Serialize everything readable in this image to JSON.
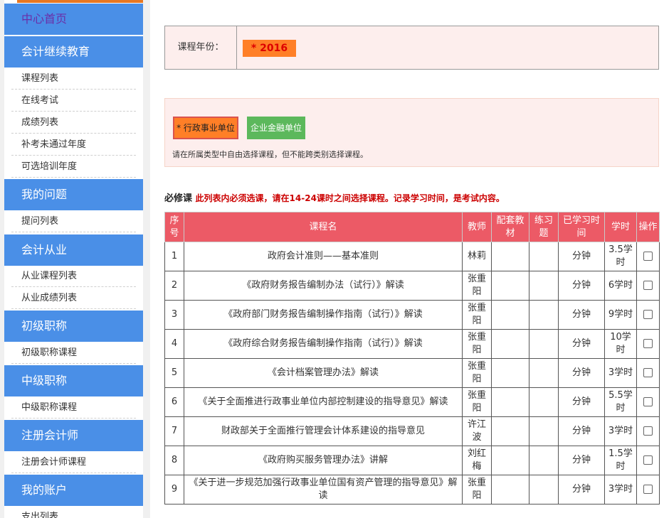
{
  "sidebar": {
    "sections": [
      {
        "title": "中心首页",
        "items": []
      },
      {
        "title": "会计继续教育",
        "items": [
          "课程列表",
          "在线考试",
          "成绩列表",
          "补考未通过年度",
          "可选培训年度"
        ]
      },
      {
        "title": "我的问题",
        "items": [
          "提问列表"
        ]
      },
      {
        "title": "会计从业",
        "items": [
          "从业课程列表",
          "从业成绩列表"
        ]
      },
      {
        "title": "初级职称",
        "items": [
          "初级职称课程"
        ]
      },
      {
        "title": "中级职称",
        "items": [
          "中级职称课程"
        ]
      },
      {
        "title": "注册会计师",
        "items": [
          "注册会计师课程"
        ]
      },
      {
        "title": "我的账户",
        "items": [
          "支出列表"
        ]
      }
    ]
  },
  "year": {
    "label": "课程年份：",
    "value": "* 2016"
  },
  "types": {
    "option1": "* 行政事业单位",
    "option2": "企业金融单位",
    "note": "请在所属类型中自由选择课程，但不能跨类别选择课程。"
  },
  "section": {
    "title": "必修课",
    "requirement": "此列表内必须选课，请在14-24课时之间选择课程。记录学习时间，是考试内容。"
  },
  "table": {
    "headers": [
      "序号",
      "课程名",
      "教师",
      "配套教材",
      "练习题",
      "已学习时间",
      "学时",
      "操作"
    ],
    "rows": [
      {
        "no": "1",
        "name": "政府会计准则——基本准则",
        "teacher": "林莉",
        "material": "",
        "exercise": "",
        "studied": "分钟",
        "hours": "3.5学时"
      },
      {
        "no": "2",
        "name": "《政府财务报告编制办法（试行）》解读",
        "teacher": "张重阳",
        "material": "",
        "exercise": "",
        "studied": "分钟",
        "hours": "6学时"
      },
      {
        "no": "3",
        "name": "《政府部门财务报告编制操作指南（试行）》解读",
        "teacher": "张重阳",
        "material": "",
        "exercise": "",
        "studied": "分钟",
        "hours": "9学时"
      },
      {
        "no": "4",
        "name": "《政府综合财务报告编制操作指南（试行）》解读",
        "teacher": "张重阳",
        "material": "",
        "exercise": "",
        "studied": "分钟",
        "hours": "10学时"
      },
      {
        "no": "5",
        "name": "《会计档案管理办法》解读",
        "teacher": "张重阳",
        "material": "",
        "exercise": "",
        "studied": "分钟",
        "hours": "3学时"
      },
      {
        "no": "6",
        "name": "《关于全面推进行政事业单位内部控制建设的指导意见》解读",
        "teacher": "张重阳",
        "material": "",
        "exercise": "",
        "studied": "分钟",
        "hours": "5.5学时"
      },
      {
        "no": "7",
        "name": "财政部关于全面推行管理会计体系建设的指导意见",
        "teacher": "许江波",
        "material": "",
        "exercise": "",
        "studied": "分钟",
        "hours": "3学时"
      },
      {
        "no": "8",
        "name": "《政府购买服务管理办法》讲解",
        "teacher": "刘红梅",
        "material": "",
        "exercise": "",
        "studied": "分钟",
        "hours": "1.5学时"
      },
      {
        "no": "9",
        "name": "《关于进一步规范加强行政事业单位国有资产管理的指导意见》解读",
        "teacher": "张重阳",
        "material": "",
        "exercise": "",
        "studied": "分钟",
        "hours": "3学时"
      }
    ]
  }
}
